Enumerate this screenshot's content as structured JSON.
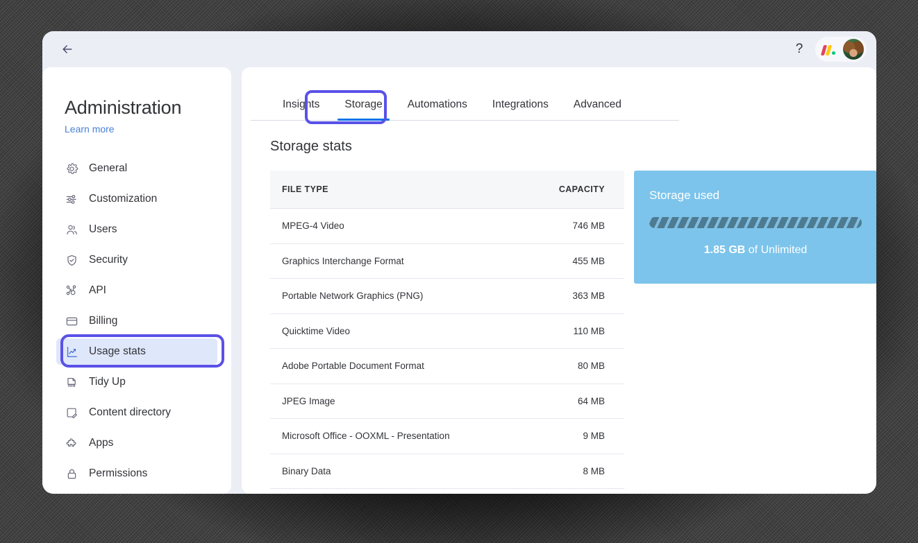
{
  "topbar": {
    "back_icon": "arrow-left-icon",
    "help_label": "?",
    "brand_icon": "monday-logo",
    "avatar_icon": "user-avatar"
  },
  "sidebar": {
    "title": "Administration",
    "learn_more": "Learn more",
    "items": [
      {
        "label": "General",
        "icon": "gear-icon",
        "selected": false
      },
      {
        "label": "Customization",
        "icon": "sliders-icon",
        "selected": false
      },
      {
        "label": "Users",
        "icon": "users-icon",
        "selected": false
      },
      {
        "label": "Security",
        "icon": "shield-check-icon",
        "selected": false
      },
      {
        "label": "API",
        "icon": "api-nodes-icon",
        "selected": false
      },
      {
        "label": "Billing",
        "icon": "credit-card-icon",
        "selected": false
      },
      {
        "label": "Usage stats",
        "icon": "chart-line-icon",
        "selected": true
      },
      {
        "label": "Tidy Up",
        "icon": "broom-icon",
        "selected": false
      },
      {
        "label": "Content directory",
        "icon": "edit-document-icon",
        "selected": false
      },
      {
        "label": "Apps",
        "icon": "puzzle-icon",
        "selected": false
      },
      {
        "label": "Permissions",
        "icon": "lock-icon",
        "selected": false
      }
    ]
  },
  "main": {
    "tabs": [
      {
        "label": "Insights",
        "active": false
      },
      {
        "label": "Storage",
        "active": true
      },
      {
        "label": "Automations",
        "active": false
      },
      {
        "label": "Integrations",
        "active": false
      },
      {
        "label": "Advanced",
        "active": false
      }
    ],
    "section_title": "Storage stats",
    "table": {
      "columns": [
        "FILE TYPE",
        "CAPACITY"
      ],
      "rows": [
        {
          "file_type": "MPEG-4 Video",
          "capacity": "746 MB"
        },
        {
          "file_type": "Graphics Interchange Format",
          "capacity": "455 MB"
        },
        {
          "file_type": "Portable Network Graphics (PNG)",
          "capacity": "363 MB"
        },
        {
          "file_type": "Quicktime Video",
          "capacity": "110 MB"
        },
        {
          "file_type": "Adobe Portable Document Format",
          "capacity": "80 MB"
        },
        {
          "file_type": "JPEG Image",
          "capacity": "64 MB"
        },
        {
          "file_type": "Microsoft Office - OOXML - Presentation",
          "capacity": "9 MB"
        },
        {
          "file_type": "Binary Data",
          "capacity": "8 MB"
        }
      ]
    },
    "storage_card": {
      "title": "Storage used",
      "used": "1.85 GB",
      "of_label": " of Unlimited",
      "background_color": "#7cc4eb",
      "bar_stripe_dark": "#4d7b92",
      "bar_stripe_light": "#7fbde0"
    }
  },
  "highlights": {
    "ring_color": "#5a51e8",
    "selected_nav_background": "#dfe7fb",
    "active_tab_underline": "#0073ea"
  }
}
